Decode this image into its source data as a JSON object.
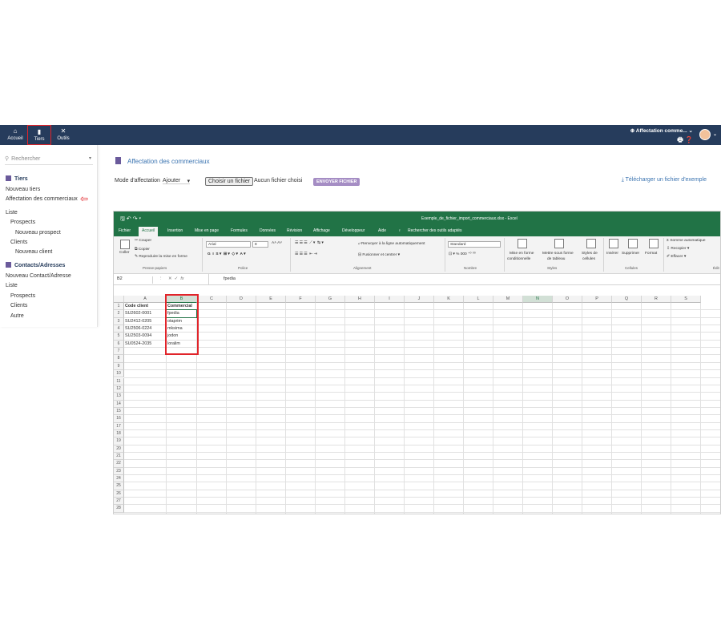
{
  "topnav": {
    "items": [
      {
        "label": "Accueil",
        "icon": "home-icon"
      },
      {
        "label": "Tiers",
        "icon": "building-icon"
      },
      {
        "label": "Outils",
        "icon": "tools-icon"
      }
    ],
    "right_title": "Affectation comme...",
    "right_caret": "⌄",
    "right_icons": "🖶 ❓"
  },
  "sidebar": {
    "search_placeholder": "Rechercher",
    "sections": [
      {
        "label": "Tiers"
      },
      {
        "label": "Contacts/Adresses"
      }
    ],
    "items": [
      "Nouveau tiers",
      "Affectation des commerciaux",
      "Liste",
      "Prospects",
      "Nouveau prospect",
      "Clients",
      "Nouveau client",
      "Nouveau Contact/Adresse",
      "Liste",
      "Prospects",
      "Clients",
      "Autre"
    ],
    "arrow": "⇦"
  },
  "main": {
    "title": "Affectation des commerciaux",
    "mode_label": "Mode d'affectation",
    "mode_value": "Ajouter",
    "file_button": "Choisir un fichier",
    "file_status": "Aucun fichier choisi",
    "send_button": "ENVOYER FICHIER",
    "download_link": "Télécharger un fichier d'exemple",
    "download_icon": "⤓"
  },
  "excel": {
    "filename": "Exemple_de_fichier_import_commerciaux.xlsx - Excel",
    "tabs": [
      "Fichier",
      "Accueil",
      "Insertion",
      "Mise en page",
      "Formules",
      "Données",
      "Révision",
      "Affichage",
      "Développeur",
      "Aide",
      "Rechercher des outils adaptés"
    ],
    "ribbon": {
      "paste": "Coller",
      "cut": "Couper",
      "copy": "Copier",
      "format_painter": "Reproduire la mise en forme",
      "clipboard_group": "Presse-papiers",
      "font_name": "Arial",
      "font_size": "8",
      "font_group": "Police",
      "wrap": "Renvoyer à la ligne automatiquement",
      "merge": "Fusionner et centrer",
      "align_group": "Alignement",
      "number_format": "Standard",
      "number_group": "Nombre",
      "cond_format_1": "Mise en forme",
      "cond_format_2": "conditionnelle",
      "table_format_1": "Mettre sous forme",
      "table_format_2": "de tableau",
      "cell_styles_1": "Styles de",
      "cell_styles_2": "cellules",
      "styles_group": "Styles",
      "insert": "Insérer",
      "delete": "Supprimer",
      "format": "Format",
      "cells_group": "Cellules",
      "autosum": "Somme automatique",
      "fill": "Recopier",
      "clear": "Effacer",
      "edit_group": "Édit"
    },
    "name_box": "B2",
    "formula_value": "fpedia",
    "columns": [
      "A",
      "B",
      "C",
      "D",
      "E",
      "F",
      "G",
      "H",
      "I",
      "J",
      "K",
      "L",
      "M",
      "N",
      "O",
      "P",
      "Q",
      "R",
      "S"
    ],
    "row_count": 28,
    "headers": [
      "Code client",
      "Commercial"
    ],
    "rows": [
      [
        "SU2602-0001",
        "fpedia"
      ],
      [
        "SU2412-0205",
        "otaprim"
      ],
      [
        "SU2506-0224",
        "mksima"
      ],
      [
        "SU2503-0094",
        "jodon"
      ],
      [
        "SU0524-2035",
        "loralim"
      ]
    ]
  }
}
